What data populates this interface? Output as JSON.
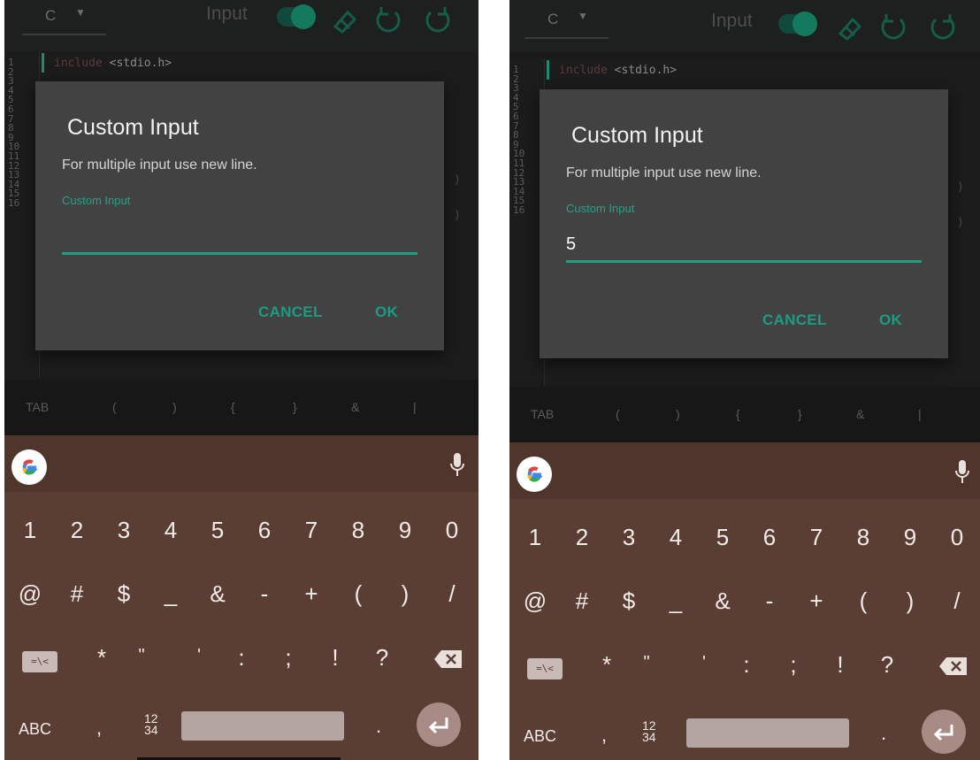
{
  "toolbar": {
    "language": "C",
    "input_label": "Input",
    "icons": [
      "dropdown-caret",
      "toggle",
      "eraser-icon",
      "undo-icon",
      "redo-icon"
    ]
  },
  "editor": {
    "line_numbers": [
      "1",
      "2",
      "3",
      "4",
      "5",
      "6",
      "7",
      "8",
      "9",
      "10",
      "11",
      "12",
      "13",
      "14",
      "15",
      "16"
    ],
    "first_line_keyword": "include",
    "first_line_rest": " <stdio.h>"
  },
  "dialog": {
    "title": "Custom Input",
    "message": "For multiple input use new line.",
    "hint": "Custom Input",
    "cancel_label": "CANCEL",
    "ok_label": "OK"
  },
  "screens": [
    {
      "input_value": ""
    },
    {
      "input_value": "5"
    }
  ],
  "extra_keys": [
    "TAB",
    "(",
    ")",
    "{",
    "}",
    "&",
    "|"
  ],
  "keyboard": {
    "row1": [
      "1",
      "2",
      "3",
      "4",
      "5",
      "6",
      "7",
      "8",
      "9",
      "0"
    ],
    "row2": [
      "@",
      "#",
      "$",
      "_",
      "&",
      "-",
      "+",
      "(",
      ")",
      "/"
    ],
    "row3": [
      "*",
      "\"",
      "'",
      ":",
      ";",
      "!",
      "?"
    ],
    "sym_label": "=\\<",
    "abc_label": "ABC",
    "comma": ",",
    "numpad_top": "12",
    "numpad_bottom": "34",
    "period": "."
  },
  "colors": {
    "accent": "#1e9f80",
    "dialog_bg": "#424242",
    "keyboard_bg": "#5a3d33"
  }
}
